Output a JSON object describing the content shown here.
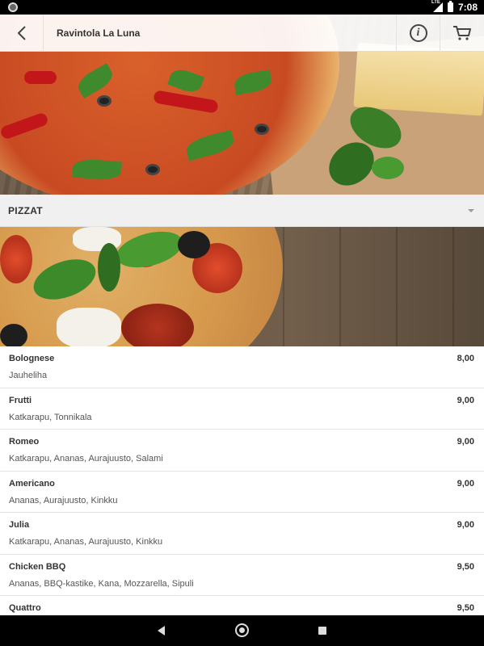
{
  "status_bar": {
    "time": "7:08",
    "network": "LTE"
  },
  "header": {
    "title": "Ravintola La Luna",
    "back_icon": "chevron-left-icon",
    "info_icon": "info-icon",
    "cart_icon": "cart-icon"
  },
  "category": {
    "label": "PIZZAT"
  },
  "menu": {
    "items": [
      {
        "name": "Bolognese",
        "desc": "Jauheliha",
        "price": "8,00"
      },
      {
        "name": "Frutti",
        "desc": "Katkarapu, Tonnikala",
        "price": "9,00"
      },
      {
        "name": "Romeo",
        "desc": "Katkarapu, Ananas, Aurajuusto, Salami",
        "price": "9,00"
      },
      {
        "name": "Americano",
        "desc": "Ananas, Aurajuusto, Kinkku",
        "price": "9,00"
      },
      {
        "name": "Julia",
        "desc": "Katkarapu, Ananas, Aurajuusto, Kinkku",
        "price": "9,00"
      },
      {
        "name": "Chicken BBQ",
        "desc": "Ananas, BBQ-kastike, Kana, Mozzarella, Sipuli",
        "price": "9,50"
      },
      {
        "name": "Quattro",
        "desc": "",
        "price": "9,50"
      }
    ]
  }
}
